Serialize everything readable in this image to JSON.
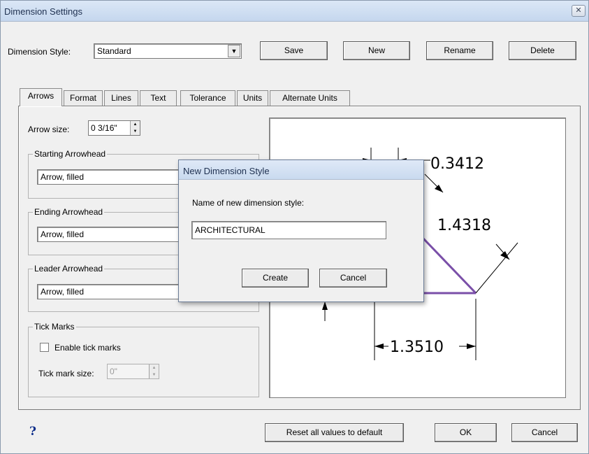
{
  "window": {
    "title": "Dimension Settings"
  },
  "style_row": {
    "label": "Dimension Style:",
    "selected": "Standard",
    "buttons": {
      "save": "Save",
      "new": "New",
      "rename": "Rename",
      "delete": "Delete"
    }
  },
  "tabs": [
    "Arrows",
    "Format",
    "Lines",
    "Text",
    "Tolerance",
    "Units",
    "Alternate Units"
  ],
  "arrows_tab": {
    "arrow_size_label": "Arrow size:",
    "arrow_size_value": "0 3/16\"",
    "starting": {
      "title": "Starting Arrowhead",
      "value": "Arrow, filled"
    },
    "ending": {
      "title": "Ending Arrowhead",
      "value": "Arrow, filled"
    },
    "leader": {
      "title": "Leader Arrowhead",
      "value": "Arrow, filled"
    },
    "tick_marks": {
      "title": "Tick Marks",
      "enable_label": "Enable tick marks",
      "enabled": false,
      "size_label": "Tick mark size:",
      "size_value": "0\""
    }
  },
  "preview": {
    "dim_top": "0.3412",
    "dim_diag": "1.4318",
    "dim_bottom": "1.3510",
    "shape_color": "#7a4fa8"
  },
  "modal": {
    "title": "New Dimension Style",
    "prompt": "Name of new dimension style:",
    "value": "ARCHITECTURAL",
    "create": "Create",
    "cancel": "Cancel"
  },
  "footer": {
    "help": "?",
    "reset": "Reset all values to default",
    "ok": "OK",
    "cancel": "Cancel"
  }
}
